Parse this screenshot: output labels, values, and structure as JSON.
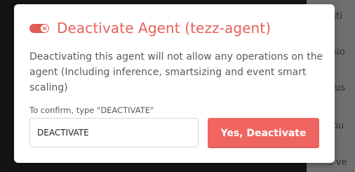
{
  "modal": {
    "title": "Deactivate Agent (tezz-agent)",
    "description": "Deactivating this agent will not allow any operations on the agent (Including inference, smartsizing and event smart scaling)",
    "confirm_label": "To confirm, type \"DEACTIVATE\"",
    "input_value": "DEACTIVATE",
    "confirm_button": "Yes, Deactivate",
    "toggle_icon": "toggle-off-x-icon"
  },
  "background": {
    "labels": [
      "cati",
      "rsio",
      "tus",
      "ou",
      "s ve"
    ]
  },
  "colors": {
    "accent": "#e8605a",
    "button": "#f06560"
  }
}
